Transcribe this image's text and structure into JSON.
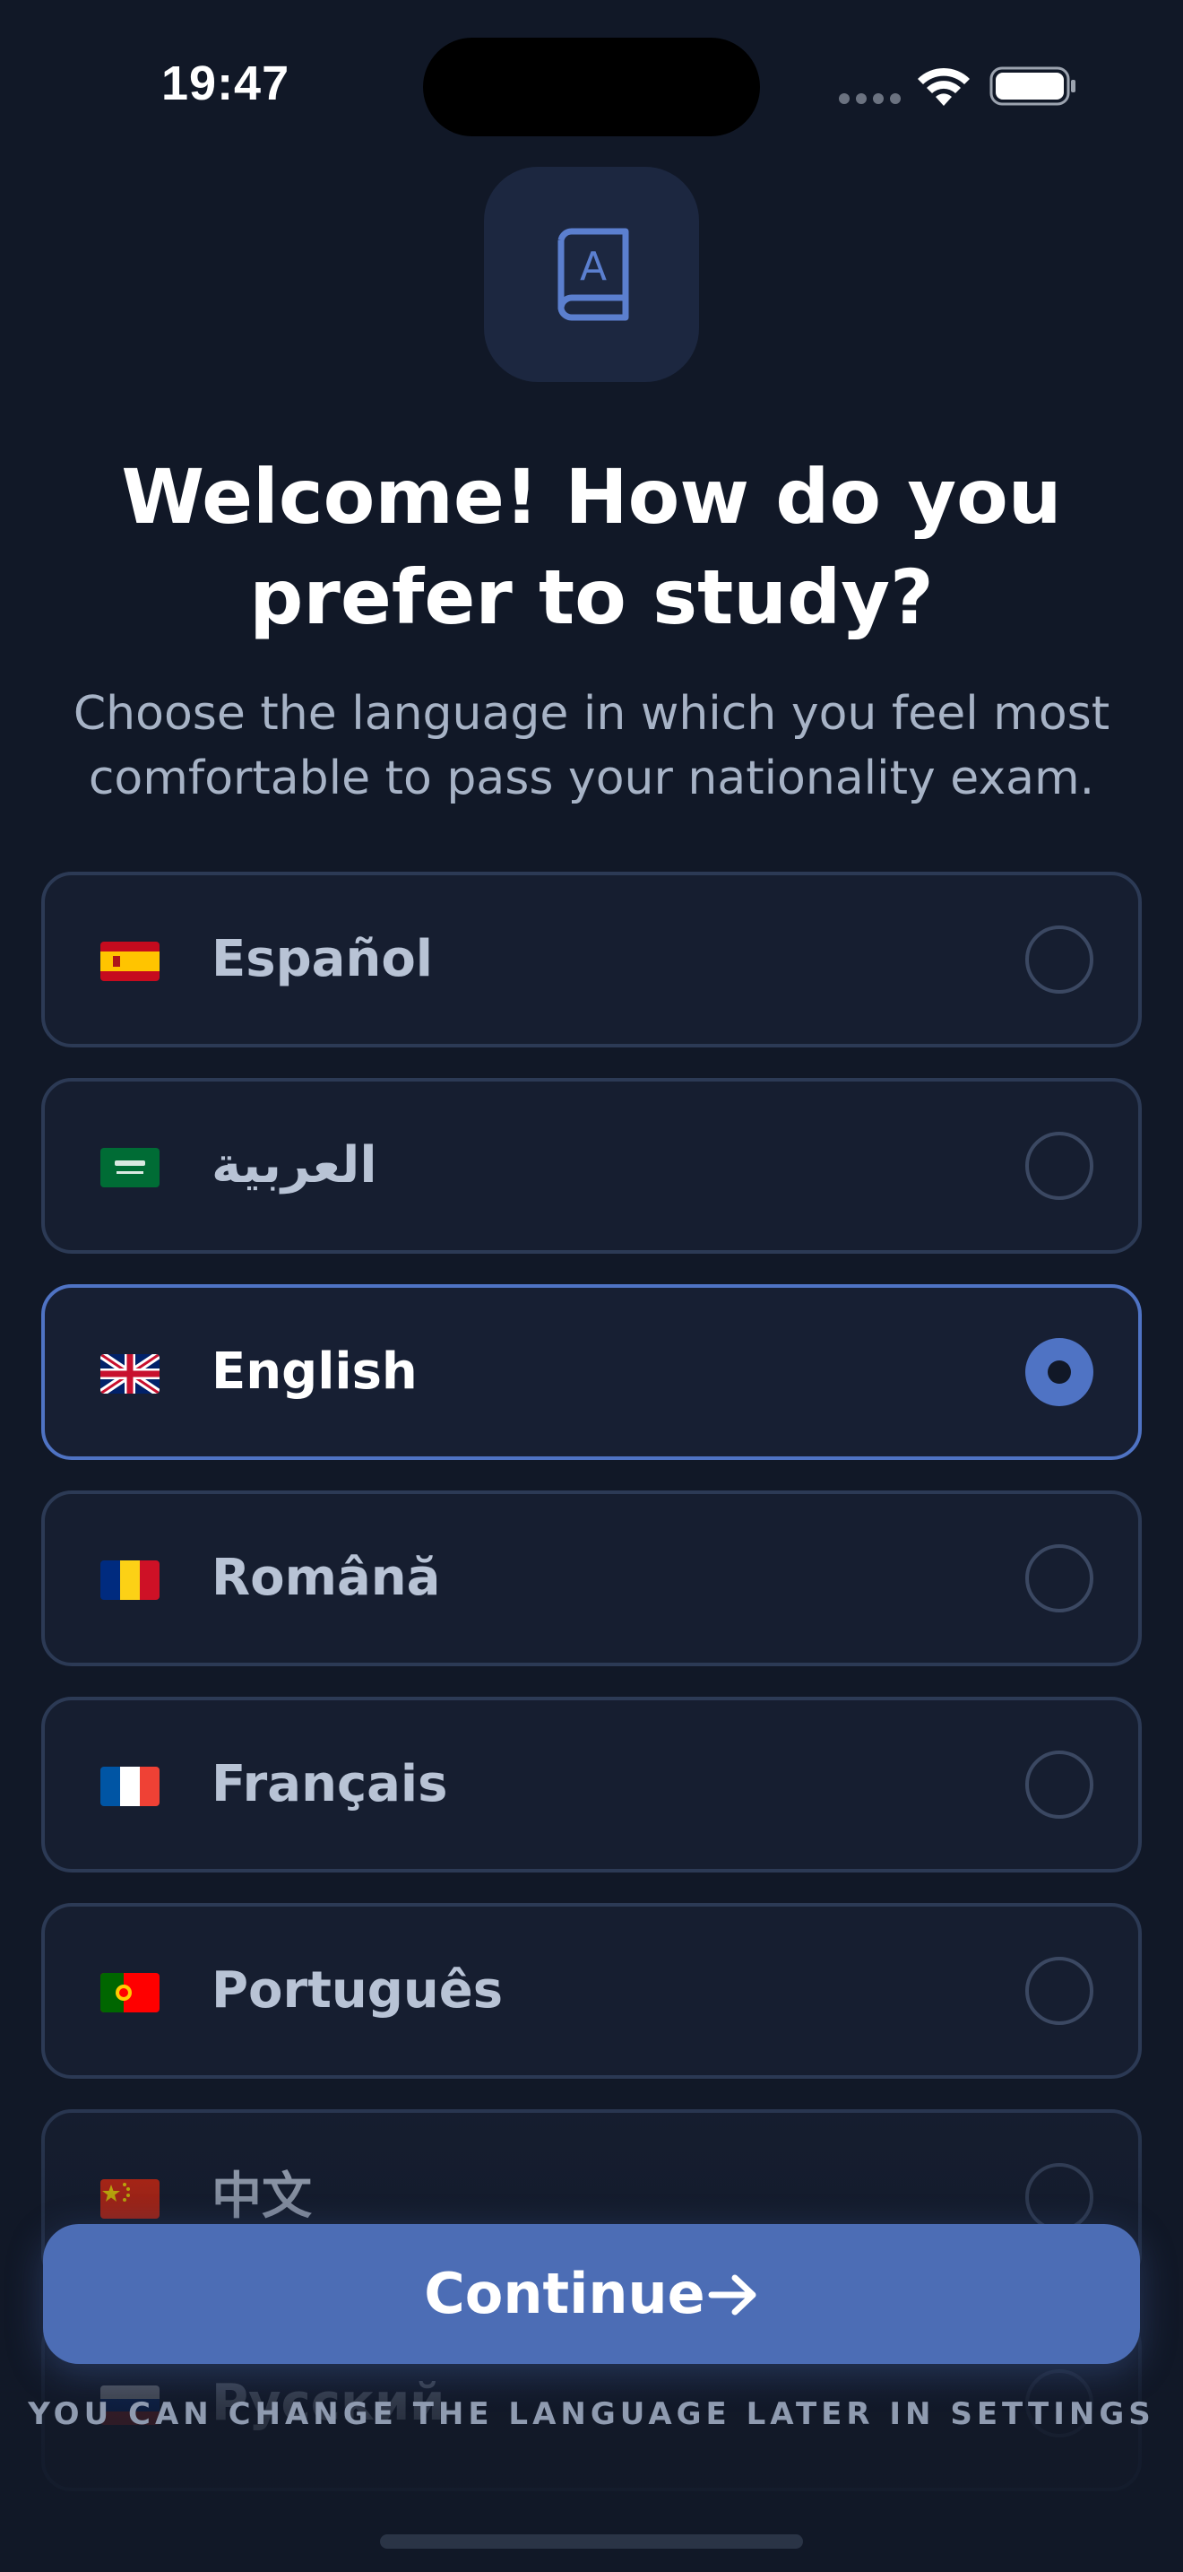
{
  "status_bar": {
    "time": "19:47",
    "icons": [
      "cellular-signal-icon",
      "wifi-icon",
      "battery-icon"
    ]
  },
  "app_icon": {
    "icon": "language-book-icon",
    "glyph": "A"
  },
  "header": {
    "title": "Welcome! How do you prefer to study?",
    "subtitle": "Choose the language in which you feel most comfortable to pass your nationality exam."
  },
  "languages": [
    {
      "label": "Español",
      "flag": "spain-flag-icon",
      "selected": false
    },
    {
      "label": "العربية",
      "flag": "saudi-arabia-flag-icon",
      "selected": false
    },
    {
      "label": "English",
      "flag": "uk-flag-icon",
      "selected": true
    },
    {
      "label": "Română",
      "flag": "romania-flag-icon",
      "selected": false
    },
    {
      "label": "Français",
      "flag": "france-flag-icon",
      "selected": false
    },
    {
      "label": "Português",
      "flag": "portugal-flag-icon",
      "selected": false
    },
    {
      "label": "中文",
      "flag": "china-flag-icon",
      "selected": false
    },
    {
      "label": "Русский",
      "flag": "russia-flag-icon",
      "selected": false
    }
  ],
  "continue_button": {
    "label": "Continue",
    "icon": "arrow-right-icon"
  },
  "footer": {
    "note": "YOU CAN CHANGE THE LANGUAGE LATER IN SETTINGS"
  },
  "colors": {
    "background": "#111827",
    "card": "#161e30",
    "card_border": "#2c3a55",
    "accent": "#4c6db5",
    "selected_border": "#4f73c4",
    "muted_text": "#a7b3c6"
  }
}
